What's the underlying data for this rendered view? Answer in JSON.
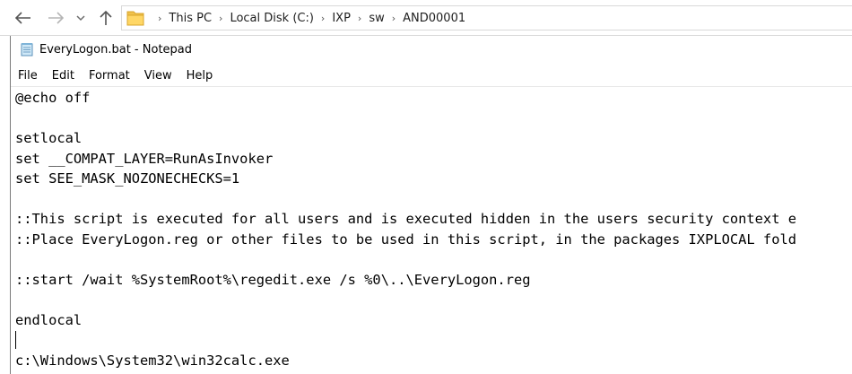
{
  "explorer": {
    "breadcrumbs": [
      "This PC",
      "Local Disk (C:)",
      "IXP",
      "sw",
      "AND00001"
    ]
  },
  "notepad": {
    "title": "EveryLogon.bat - Notepad",
    "menu": [
      "File",
      "Edit",
      "Format",
      "View",
      "Help"
    ],
    "lines": [
      "@echo off",
      "",
      "setlocal",
      "set __COMPAT_LAYER=RunAsInvoker",
      "set SEE_MASK_NOZONECHECKS=1",
      "",
      "::This script is executed for all users and is executed hidden in the users security context e",
      "::Place EveryLogon.reg or other files to be used in this script, in the packages IXPLOCAL fold",
      "",
      "::start /wait %SystemRoot%\\regedit.exe /s %0\\..\\EveryLogon.reg",
      "",
      "endlocal",
      "",
      "c:\\Windows\\System32\\win32calc.exe"
    ]
  }
}
